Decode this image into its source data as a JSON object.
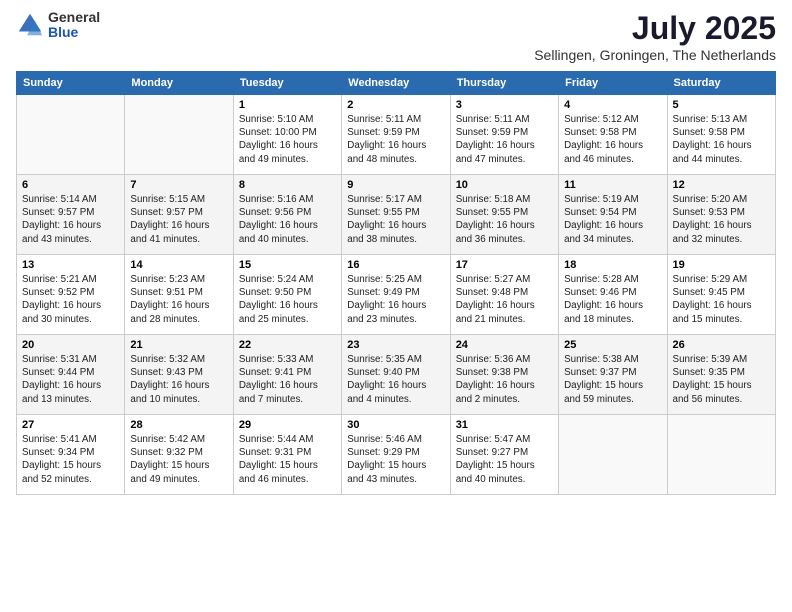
{
  "header": {
    "logo_general": "General",
    "logo_blue": "Blue",
    "month_title": "July 2025",
    "location": "Sellingen, Groningen, The Netherlands"
  },
  "weekdays": [
    "Sunday",
    "Monday",
    "Tuesday",
    "Wednesday",
    "Thursday",
    "Friday",
    "Saturday"
  ],
  "weeks": [
    [
      {
        "day": "",
        "info": ""
      },
      {
        "day": "",
        "info": ""
      },
      {
        "day": "1",
        "info": "Sunrise: 5:10 AM\nSunset: 10:00 PM\nDaylight: 16 hours and 49 minutes."
      },
      {
        "day": "2",
        "info": "Sunrise: 5:11 AM\nSunset: 9:59 PM\nDaylight: 16 hours and 48 minutes."
      },
      {
        "day": "3",
        "info": "Sunrise: 5:11 AM\nSunset: 9:59 PM\nDaylight: 16 hours and 47 minutes."
      },
      {
        "day": "4",
        "info": "Sunrise: 5:12 AM\nSunset: 9:58 PM\nDaylight: 16 hours and 46 minutes."
      },
      {
        "day": "5",
        "info": "Sunrise: 5:13 AM\nSunset: 9:58 PM\nDaylight: 16 hours and 44 minutes."
      }
    ],
    [
      {
        "day": "6",
        "info": "Sunrise: 5:14 AM\nSunset: 9:57 PM\nDaylight: 16 hours and 43 minutes."
      },
      {
        "day": "7",
        "info": "Sunrise: 5:15 AM\nSunset: 9:57 PM\nDaylight: 16 hours and 41 minutes."
      },
      {
        "day": "8",
        "info": "Sunrise: 5:16 AM\nSunset: 9:56 PM\nDaylight: 16 hours and 40 minutes."
      },
      {
        "day": "9",
        "info": "Sunrise: 5:17 AM\nSunset: 9:55 PM\nDaylight: 16 hours and 38 minutes."
      },
      {
        "day": "10",
        "info": "Sunrise: 5:18 AM\nSunset: 9:55 PM\nDaylight: 16 hours and 36 minutes."
      },
      {
        "day": "11",
        "info": "Sunrise: 5:19 AM\nSunset: 9:54 PM\nDaylight: 16 hours and 34 minutes."
      },
      {
        "day": "12",
        "info": "Sunrise: 5:20 AM\nSunset: 9:53 PM\nDaylight: 16 hours and 32 minutes."
      }
    ],
    [
      {
        "day": "13",
        "info": "Sunrise: 5:21 AM\nSunset: 9:52 PM\nDaylight: 16 hours and 30 minutes."
      },
      {
        "day": "14",
        "info": "Sunrise: 5:23 AM\nSunset: 9:51 PM\nDaylight: 16 hours and 28 minutes."
      },
      {
        "day": "15",
        "info": "Sunrise: 5:24 AM\nSunset: 9:50 PM\nDaylight: 16 hours and 25 minutes."
      },
      {
        "day": "16",
        "info": "Sunrise: 5:25 AM\nSunset: 9:49 PM\nDaylight: 16 hours and 23 minutes."
      },
      {
        "day": "17",
        "info": "Sunrise: 5:27 AM\nSunset: 9:48 PM\nDaylight: 16 hours and 21 minutes."
      },
      {
        "day": "18",
        "info": "Sunrise: 5:28 AM\nSunset: 9:46 PM\nDaylight: 16 hours and 18 minutes."
      },
      {
        "day": "19",
        "info": "Sunrise: 5:29 AM\nSunset: 9:45 PM\nDaylight: 16 hours and 15 minutes."
      }
    ],
    [
      {
        "day": "20",
        "info": "Sunrise: 5:31 AM\nSunset: 9:44 PM\nDaylight: 16 hours and 13 minutes."
      },
      {
        "day": "21",
        "info": "Sunrise: 5:32 AM\nSunset: 9:43 PM\nDaylight: 16 hours and 10 minutes."
      },
      {
        "day": "22",
        "info": "Sunrise: 5:33 AM\nSunset: 9:41 PM\nDaylight: 16 hours and 7 minutes."
      },
      {
        "day": "23",
        "info": "Sunrise: 5:35 AM\nSunset: 9:40 PM\nDaylight: 16 hours and 4 minutes."
      },
      {
        "day": "24",
        "info": "Sunrise: 5:36 AM\nSunset: 9:38 PM\nDaylight: 16 hours and 2 minutes."
      },
      {
        "day": "25",
        "info": "Sunrise: 5:38 AM\nSunset: 9:37 PM\nDaylight: 15 hours and 59 minutes."
      },
      {
        "day": "26",
        "info": "Sunrise: 5:39 AM\nSunset: 9:35 PM\nDaylight: 15 hours and 56 minutes."
      }
    ],
    [
      {
        "day": "27",
        "info": "Sunrise: 5:41 AM\nSunset: 9:34 PM\nDaylight: 15 hours and 52 minutes."
      },
      {
        "day": "28",
        "info": "Sunrise: 5:42 AM\nSunset: 9:32 PM\nDaylight: 15 hours and 49 minutes."
      },
      {
        "day": "29",
        "info": "Sunrise: 5:44 AM\nSunset: 9:31 PM\nDaylight: 15 hours and 46 minutes."
      },
      {
        "day": "30",
        "info": "Sunrise: 5:46 AM\nSunset: 9:29 PM\nDaylight: 15 hours and 43 minutes."
      },
      {
        "day": "31",
        "info": "Sunrise: 5:47 AM\nSunset: 9:27 PM\nDaylight: 15 hours and 40 minutes."
      },
      {
        "day": "",
        "info": ""
      },
      {
        "day": "",
        "info": ""
      }
    ]
  ]
}
